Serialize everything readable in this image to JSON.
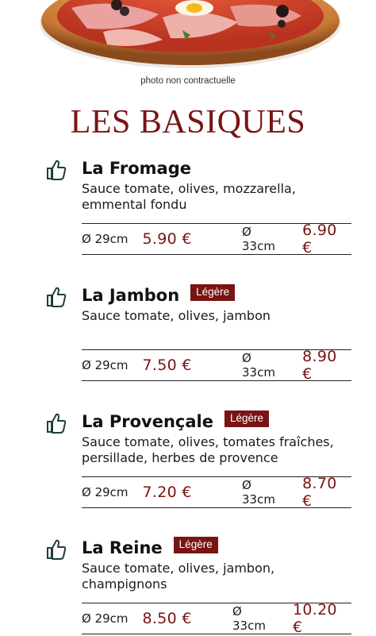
{
  "hero": {
    "photo_note": "photo non contractuelle"
  },
  "section": {
    "title": "LES BASIQUES"
  },
  "colors": {
    "accent": "#7a1313",
    "text": "#1a1a1a"
  },
  "items": [
    {
      "name": "La Fromage",
      "badge": "",
      "description": "Sauce tomate, olives, mozzarella, emmental fondu",
      "sizes": [
        {
          "label": "Ø 29cm",
          "price": "5.90 €"
        },
        {
          "label": "Ø 33cm",
          "price": "6.90 €"
        }
      ]
    },
    {
      "name": "La Jambon",
      "badge": "Légère",
      "description": "Sauce tomate, olives, jambon",
      "sizes": [
        {
          "label": "Ø 29cm",
          "price": "7.50 €"
        },
        {
          "label": "Ø 33cm",
          "price": "8.90 €"
        }
      ]
    },
    {
      "name": "La Provençale",
      "badge": "Légère",
      "description": "Sauce tomate, olives, tomates fraîches, persillade, herbes de provence",
      "sizes": [
        {
          "label": "Ø 29cm",
          "price": "7.20 €"
        },
        {
          "label": "Ø 33cm",
          "price": "8.70 €"
        }
      ]
    },
    {
      "name": "La Reine",
      "badge": "Légère",
      "description": "Sauce tomate, olives, jambon, champignons",
      "sizes": [
        {
          "label": "Ø 29cm",
          "price": "8.50 €"
        },
        {
          "label": "Ø 33cm",
          "price": "10.20 €"
        }
      ]
    }
  ]
}
